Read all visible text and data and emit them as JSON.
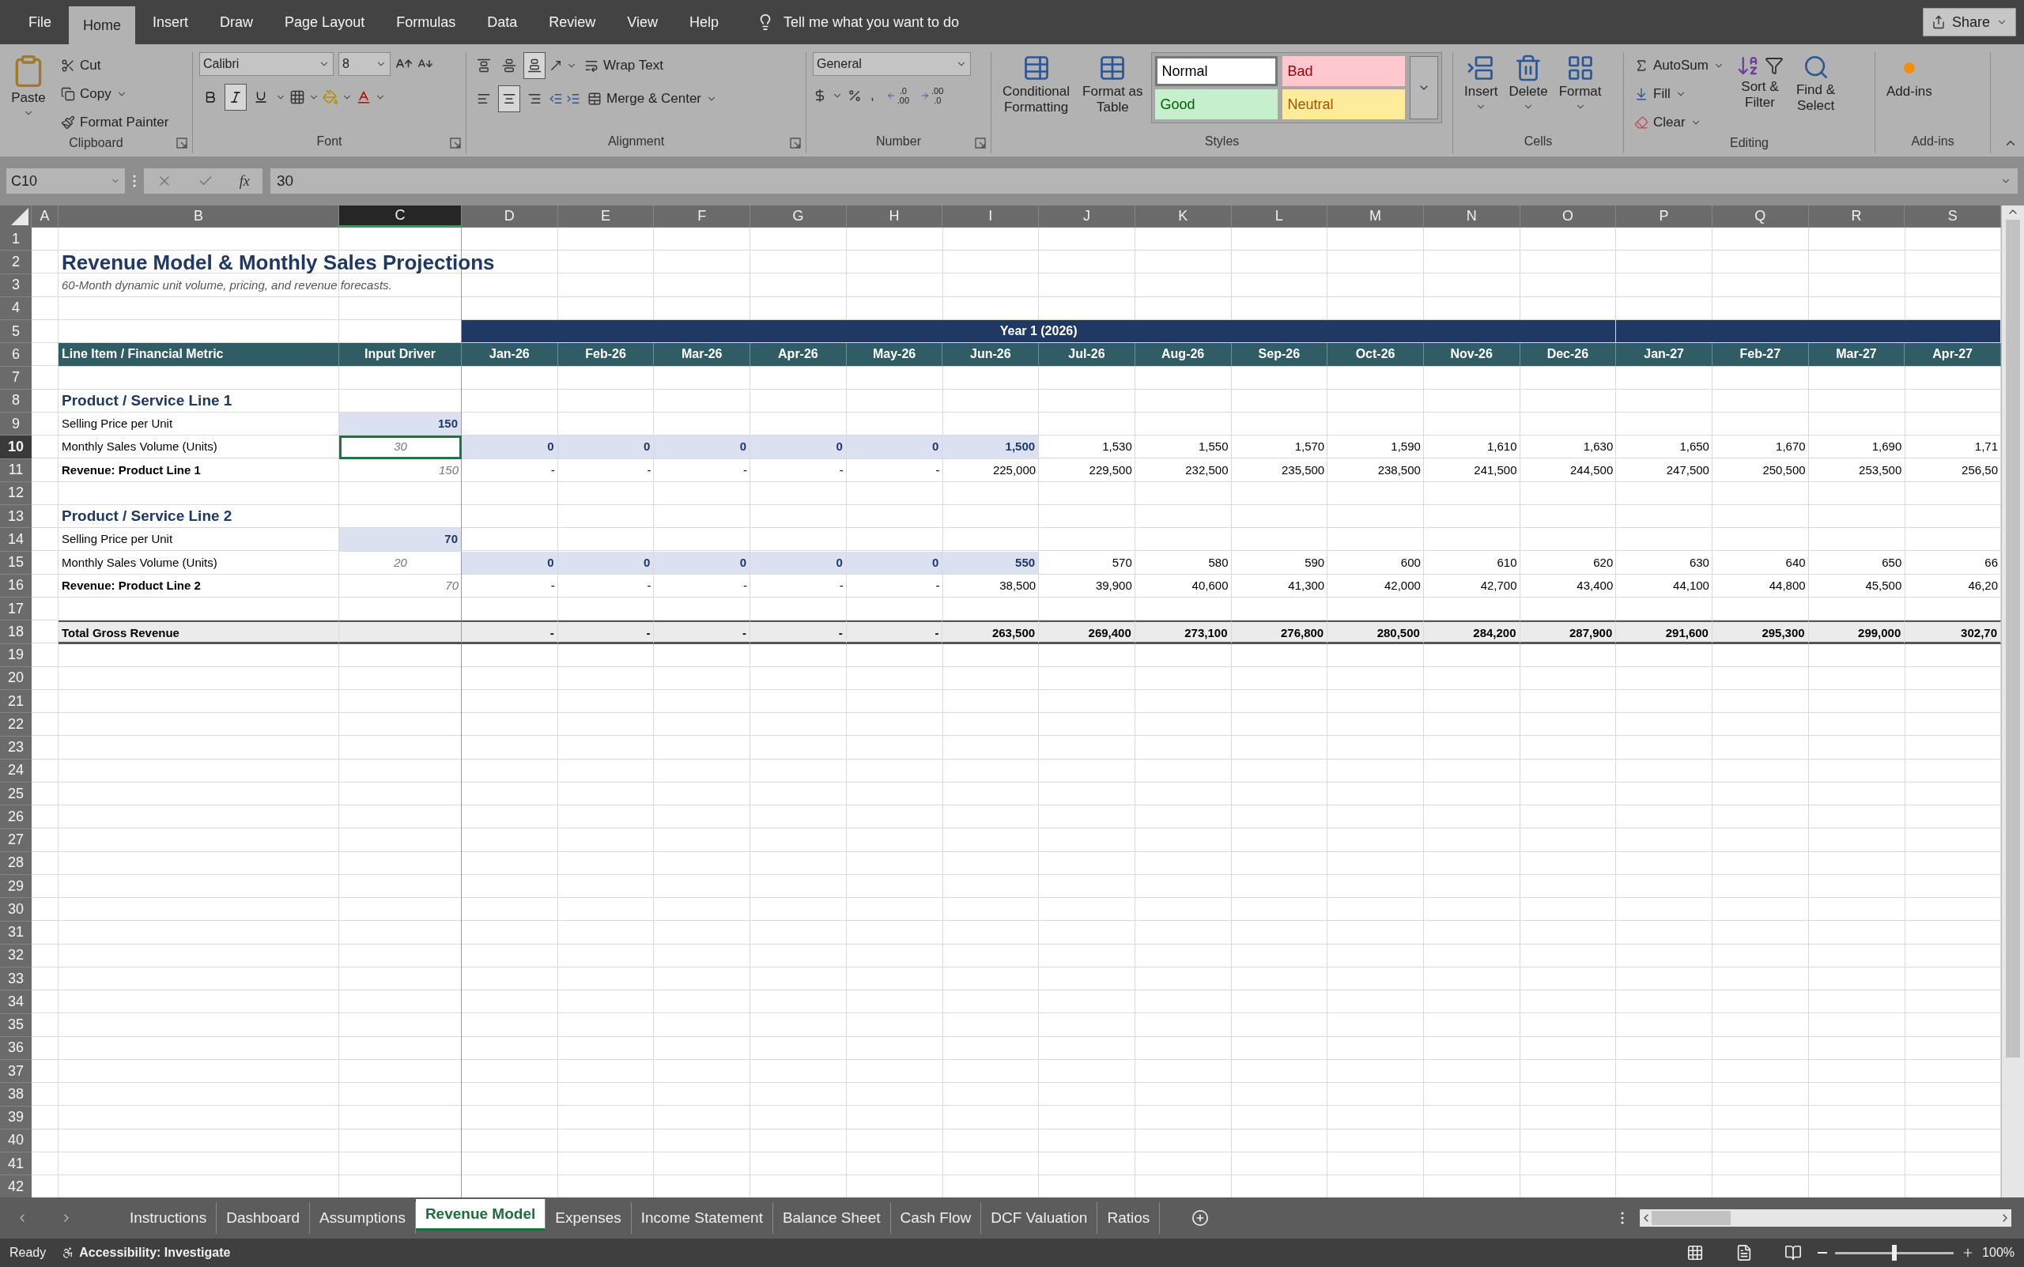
{
  "menu_tabs": [
    {
      "label": "File",
      "selected": false
    },
    {
      "label": "Home",
      "selected": true
    },
    {
      "label": "Insert",
      "selected": false
    },
    {
      "label": "Draw",
      "selected": false
    },
    {
      "label": "Page Layout",
      "selected": false
    },
    {
      "label": "Formulas",
      "selected": false
    },
    {
      "label": "Data",
      "selected": false
    },
    {
      "label": "Review",
      "selected": false
    },
    {
      "label": "View",
      "selected": false
    },
    {
      "label": "Help",
      "selected": false
    }
  ],
  "tell_me": "Tell me what you want to do",
  "share": "Share",
  "ribbon": {
    "clipboard": {
      "label": "Clipboard",
      "paste": "Paste",
      "cut": "Cut",
      "copy": "Copy",
      "format_painter": "Format Painter"
    },
    "font": {
      "label": "Font",
      "name": "Calibri",
      "size": "8",
      "bold": false,
      "italic": true,
      "underline": false
    },
    "alignment": {
      "label": "Alignment",
      "vertical": [
        {
          "kind": "top",
          "pressed": false
        },
        {
          "kind": "middle",
          "pressed": false
        },
        {
          "kind": "bottom",
          "pressed": true
        }
      ],
      "horizontal": [
        {
          "kind": "left",
          "pressed": false
        },
        {
          "kind": "center",
          "pressed": true
        },
        {
          "kind": "right",
          "pressed": false
        }
      ],
      "wrap_text": "Wrap Text",
      "merge": "Merge & Center"
    },
    "number": {
      "label": "Number",
      "format": "General",
      "comma": ",",
      "decimals": [
        {
          "kind": "increase",
          "top": ".0",
          "bottom": ".00"
        },
        {
          "kind": "decrease",
          "top": ".00",
          "bottom": ".0"
        }
      ]
    },
    "styles": {
      "label": "Styles",
      "conditional": [
        "Conditional",
        "Formatting"
      ],
      "format_table": [
        "Format as",
        "Table"
      ],
      "items": [
        {
          "kind": "normal",
          "label": "Normal",
          "color": "#ffffff",
          "selected": true
        },
        {
          "kind": "bad",
          "label": "Bad",
          "color": "#ffc7ce",
          "selected": false
        },
        {
          "kind": "good",
          "label": "Good",
          "color": "#c6efce",
          "selected": false
        },
        {
          "kind": "neutral",
          "label": "Neutral",
          "color": "#ffeb9c",
          "selected": false
        }
      ]
    },
    "cells": {
      "label": "Cells",
      "buttons": [
        {
          "kind": "insert",
          "label": "Insert"
        },
        {
          "kind": "delete",
          "label": "Delete"
        },
        {
          "kind": "format",
          "label": "Format"
        }
      ]
    },
    "editing": {
      "label": "Editing",
      "autosum": "AutoSum",
      "fill": "Fill",
      "clear": "Clear",
      "sort": [
        "Sort &",
        "Filter"
      ],
      "find": [
        "Find &",
        "Select"
      ]
    },
    "addins": {
      "label": "Add-ins",
      "button": "Add-ins"
    }
  },
  "formula_bar": {
    "name_box": "C10",
    "fx": "fx",
    "value": "30"
  },
  "sheet": {
    "columns": [
      {
        "label": "A",
        "selected": false
      },
      {
        "label": "B",
        "selected": false
      },
      {
        "label": "C",
        "selected": true
      },
      {
        "label": "D",
        "selected": false
      },
      {
        "label": "E",
        "selected": false
      },
      {
        "label": "F",
        "selected": false
      },
      {
        "label": "G",
        "selected": false
      },
      {
        "label": "H",
        "selected": false
      },
      {
        "label": "I",
        "selected": false
      },
      {
        "label": "J",
        "selected": false
      },
      {
        "label": "K",
        "selected": false
      },
      {
        "label": "L",
        "selected": false
      },
      {
        "label": "M",
        "selected": false
      },
      {
        "label": "N",
        "selected": false
      },
      {
        "label": "O",
        "selected": false
      },
      {
        "label": "P",
        "selected": false
      },
      {
        "label": "Q",
        "selected": false
      },
      {
        "label": "R",
        "selected": false
      },
      {
        "label": "S",
        "selected": false
      }
    ],
    "rows": [
      {
        "number": "1",
        "selected": false,
        "kind": "blank"
      },
      {
        "number": "2",
        "selected": false,
        "kind": "title",
        "text": "Revenue Model & Monthly Sales Projections"
      },
      {
        "number": "3",
        "selected": false,
        "kind": "subtitle",
        "text": "60-Month dynamic unit volume, pricing, and revenue forecasts."
      },
      {
        "number": "4",
        "selected": false,
        "kind": "blank"
      },
      {
        "number": "5",
        "selected": false,
        "kind": "band",
        "band": "Year 1 (2026)"
      },
      {
        "number": "6",
        "selected": false,
        "kind": "header",
        "label": "Line Item / Financial Metric",
        "driver": "Input Driver",
        "values": [
          "Jan-26",
          "Feb-26",
          "Mar-26",
          "Apr-26",
          "May-26",
          "Jun-26",
          "Jul-26",
          "Aug-26",
          "Sep-26",
          "Oct-26",
          "Nov-26",
          "Dec-26",
          "Jan-27",
          "Feb-27",
          "Mar-27",
          "Apr-27"
        ]
      },
      {
        "number": "7",
        "selected": false,
        "kind": "blank"
      },
      {
        "number": "8",
        "selected": false,
        "kind": "section",
        "label": "Product / Service Line 1"
      },
      {
        "number": "9",
        "selected": false,
        "kind": "price",
        "label": "Selling Price per Unit",
        "driver": "150"
      },
      {
        "number": "10",
        "selected": true,
        "kind": "volume",
        "label": "Monthly Sales Volume (Units)",
        "driver": "30",
        "inputs": [
          "0",
          "0",
          "0",
          "0",
          "0",
          "1,500"
        ],
        "values": [
          "1,530",
          "1,550",
          "1,570",
          "1,590",
          "1,610",
          "1,630",
          "1,650",
          "1,670",
          "1,690",
          "1,71"
        ]
      },
      {
        "number": "11",
        "selected": false,
        "kind": "revenue",
        "label": "Revenue: Product Line 1",
        "driver": "150",
        "values": [
          "-",
          "-",
          "-",
          "-",
          "-",
          "225,000",
          "229,500",
          "232,500",
          "235,500",
          "238,500",
          "241,500",
          "244,500",
          "247,500",
          "250,500",
          "253,500",
          "256,50"
        ]
      },
      {
        "number": "12",
        "selected": false,
        "kind": "blank"
      },
      {
        "number": "13",
        "selected": false,
        "kind": "section",
        "label": "Product / Service Line 2"
      },
      {
        "number": "14",
        "selected": false,
        "kind": "price",
        "label": "Selling Price per Unit",
        "driver": "70"
      },
      {
        "number": "15",
        "selected": false,
        "kind": "volume",
        "label": "Monthly Sales Volume (Units)",
        "driver": "20",
        "inputs": [
          "0",
          "0",
          "0",
          "0",
          "0",
          "550"
        ],
        "values": [
          "570",
          "580",
          "590",
          "600",
          "610",
          "620",
          "630",
          "640",
          "650",
          "66"
        ]
      },
      {
        "number": "16",
        "selected": false,
        "kind": "revenue",
        "label": "Revenue: Product Line 2",
        "driver": "70",
        "values": [
          "-",
          "-",
          "-",
          "-",
          "-",
          "38,500",
          "39,900",
          "40,600",
          "41,300",
          "42,000",
          "42,700",
          "43,400",
          "44,100",
          "44,800",
          "45,500",
          "46,20"
        ]
      },
      {
        "number": "17",
        "selected": false,
        "kind": "blank"
      },
      {
        "number": "18",
        "selected": false,
        "kind": "total",
        "label": "Total Gross Revenue",
        "values": [
          "-",
          "-",
          "-",
          "-",
          "-",
          "263,500",
          "269,400",
          "273,100",
          "276,800",
          "280,500",
          "284,200",
          "287,900",
          "291,600",
          "295,300",
          "299,000",
          "302,70"
        ]
      },
      {
        "number": "19",
        "selected": false,
        "kind": "blank"
      },
      {
        "number": "20",
        "selected": false,
        "kind": "blank"
      },
      {
        "number": "21",
        "selected": false,
        "kind": "blank"
      },
      {
        "number": "22",
        "selected": false,
        "kind": "blank"
      },
      {
        "number": "23",
        "selected": false,
        "kind": "blank"
      },
      {
        "number": "24",
        "selected": false,
        "kind": "blank"
      },
      {
        "number": "25",
        "selected": false,
        "kind": "blank"
      },
      {
        "number": "26",
        "selected": false,
        "kind": "blank"
      },
      {
        "number": "27",
        "selected": false,
        "kind": "blank"
      },
      {
        "number": "28",
        "selected": false,
        "kind": "blank"
      },
      {
        "number": "29",
        "selected": false,
        "kind": "blank"
      },
      {
        "number": "30",
        "selected": false,
        "kind": "blank"
      },
      {
        "number": "31",
        "selected": false,
        "kind": "blank"
      },
      {
        "number": "32",
        "selected": false,
        "kind": "blank"
      },
      {
        "number": "33",
        "selected": false,
        "kind": "blank"
      },
      {
        "number": "34",
        "selected": false,
        "kind": "blank"
      },
      {
        "number": "35",
        "selected": false,
        "kind": "blank"
      },
      {
        "number": "36",
        "selected": false,
        "kind": "blank"
      },
      {
        "number": "37",
        "selected": false,
        "kind": "blank"
      },
      {
        "number": "38",
        "selected": false,
        "kind": "blank"
      },
      {
        "number": "39",
        "selected": false,
        "kind": "blank"
      },
      {
        "number": "40",
        "selected": false,
        "kind": "blank"
      },
      {
        "number": "41",
        "selected": false,
        "kind": "blank"
      },
      {
        "number": "42",
        "selected": false,
        "kind": "blank"
      }
    ]
  },
  "sheet_tabs": [
    {
      "label": "Instructions",
      "selected": false
    },
    {
      "label": "Dashboard",
      "selected": false
    },
    {
      "label": "Assumptions",
      "selected": false
    },
    {
      "label": "Revenue Model",
      "selected": true
    },
    {
      "label": "Expenses",
      "selected": false
    },
    {
      "label": "Income Statement",
      "selected": false
    },
    {
      "label": "Balance Sheet",
      "selected": false
    },
    {
      "label": "Cash Flow",
      "selected": false
    },
    {
      "label": "DCF Valuation",
      "selected": false
    },
    {
      "label": "Ratios",
      "selected": false
    }
  ],
  "status_bar": {
    "ready": "Ready",
    "accessibility": "Accessibility: Investigate",
    "zoom": {
      "level": 0.5,
      "reading": "100%"
    }
  }
}
